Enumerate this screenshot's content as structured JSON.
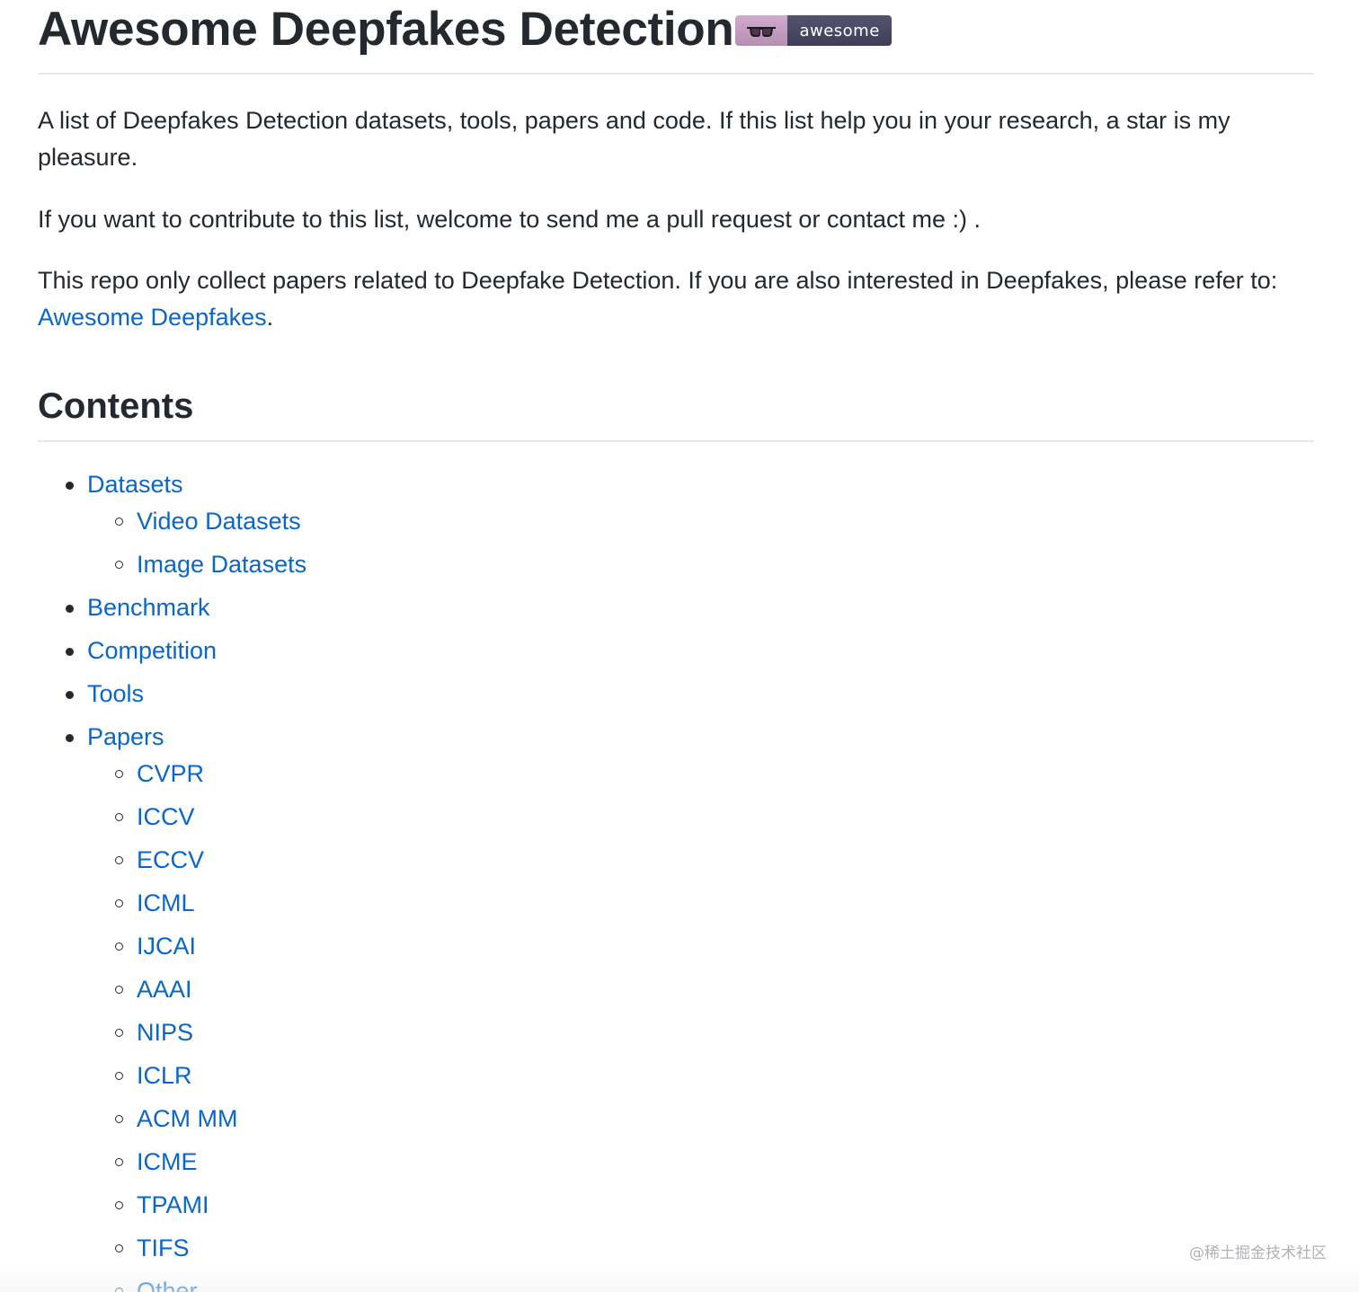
{
  "readme": {
    "title": "Awesome Deepfakes Detection",
    "badge": {
      "icon": "sunglasses-icon",
      "label": "awesome",
      "left_color": "#c59fc4",
      "right_color": "#4b4a66"
    },
    "paragraphs": {
      "intro": "A list of Deepfakes Detection datasets, tools, papers and code. If this list help you in your research, a star is my pleasure.",
      "contribute": "If you want to contribute to this list, welcome to send me a pull request or contact me :) .",
      "scope_prefix": "This repo only collect papers related to Deepfake Detection. If you are also interested in Deepfakes, please refer to: ",
      "scope_link": "Awesome Deepfakes",
      "scope_suffix": "."
    },
    "contents_heading": "Contents",
    "toc": {
      "datasets": {
        "label": "Datasets",
        "children": [
          "Video Datasets",
          "Image Datasets"
        ]
      },
      "benchmark": "Benchmark",
      "competition": "Competition",
      "tools": "Tools",
      "papers": {
        "label": "Papers",
        "children": [
          "CVPR",
          "ICCV",
          "ECCV",
          "ICML",
          "IJCAI",
          "AAAI",
          "NIPS",
          "ICLR",
          "ACM MM",
          "ICME",
          "TPAMI",
          "TIFS",
          "Other"
        ]
      }
    },
    "link_color": "#0a67c8"
  },
  "watermark": "@稀土掘金技术社区"
}
